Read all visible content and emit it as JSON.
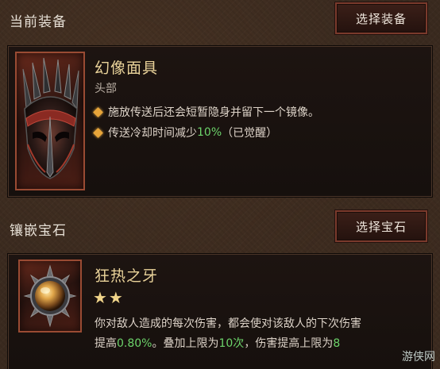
{
  "equipment_section": {
    "title": "当前装备",
    "select_button": "选择装备",
    "item": {
      "name": "幻像面具",
      "slot": "头部",
      "effects": [
        {
          "text": "施放传送后还会短暂隐身并留下一个镜像。"
        },
        {
          "prefix": "传送冷却时间减少",
          "highlight": "10%",
          "suffix": "（已觉醒）"
        }
      ]
    }
  },
  "gem_section": {
    "title": "镶嵌宝石",
    "select_button": "选择宝石",
    "gem": {
      "name": "狂热之牙",
      "stars": "★★",
      "desc_line1": "你对敌人造成的每次伤害，都会使对该敌人的下次伤害",
      "desc_line2_a": "提高",
      "desc_line2_b": "0.80%",
      "desc_line2_c": "。叠加上限为",
      "desc_line2_d": "10次",
      "desc_line2_e": "，伤害提高上限为",
      "desc_line2_f": "8"
    }
  },
  "watermark": {
    "text": "游侠网"
  },
  "colors": {
    "highlight_green": "#6cd36a",
    "item_name_gold": "#ead39a",
    "diamond_bullet": "#e8a53a",
    "button_border": "#7a3a2c"
  }
}
